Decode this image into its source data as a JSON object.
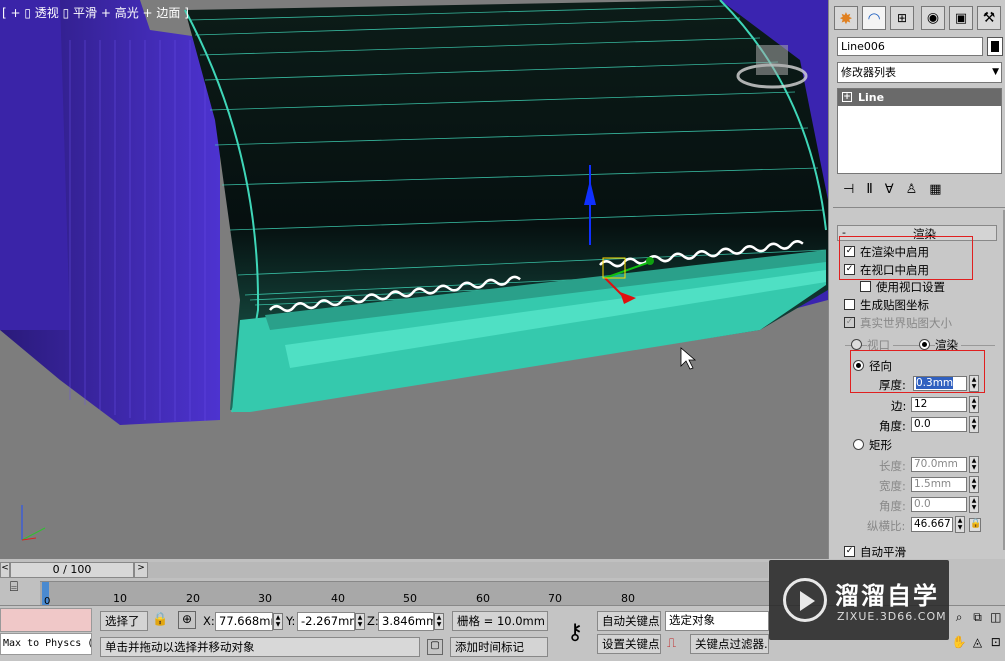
{
  "viewport": {
    "label": "[ + ▯ 透视 ▯ 平滑 + 高光 + 边面 ]"
  },
  "panel": {
    "object_name": "Line006",
    "modifier_list": "修改器列表",
    "stack_item": "Line",
    "rollout_title": "渲染",
    "enable_in_renderer": "在渲染中启用",
    "enable_in_viewport": "在视口中启用",
    "use_viewport_settings": "使用视口设置",
    "generate_mapping": "生成贴图坐标",
    "real_world_map": "真实世界贴图大小",
    "viewport_radio": "视口",
    "render_radio": "渲染",
    "radial": "径向",
    "thickness_label": "厚度:",
    "thickness_value": "0.3mm",
    "sides_label": "边:",
    "sides_value": "12",
    "angle_label": "角度:",
    "angle_value": "0.0",
    "rectangular": "矩形",
    "length_label": "长度:",
    "length_value": "70.0mm",
    "width_label": "宽度:",
    "width_value": "1.5mm",
    "rect_angle_label": "角度:",
    "rect_angle_value": "0.0",
    "aspect_label": "纵横比:",
    "aspect_value": "46.667",
    "auto_smooth": "自动平滑"
  },
  "timeline": {
    "frame": "0 / 100",
    "ticks": [
      "0",
      "10",
      "20",
      "30",
      "40",
      "50",
      "60",
      "70",
      "80"
    ]
  },
  "status": {
    "maxscript": "Max to Physcs (",
    "selected": "选择了",
    "x_label": "X:",
    "x_value": "77.668mm",
    "y_label": "Y:",
    "y_value": "-2.267mm",
    "z_label": "Z:",
    "z_value": "3.846mm",
    "grid": "栅格 = 10.0mm",
    "auto_key": "自动关键点",
    "set_key": "设置关键点",
    "selection_set": "选定对象",
    "key_filters": "关键点过滤器...",
    "prompt": "单击并拖动以选择并移动对象",
    "add_time_tag": "添加时间标记"
  },
  "watermark": {
    "brand": "溜溜自学",
    "url": "ZIXUE.3D66.COM"
  },
  "colors": {
    "viewport_bg": "#7d7d7d",
    "cyan_mesh": "#3fd6b8",
    "purple_mesh": "#4a2fc0",
    "red_highlight": "#e02020"
  }
}
